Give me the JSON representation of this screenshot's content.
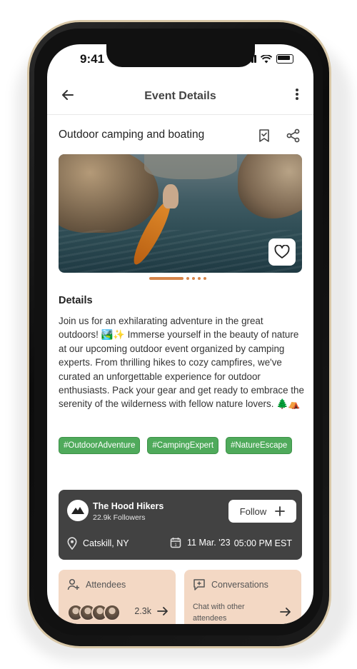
{
  "status_bar": {
    "time": "9:41"
  },
  "header": {
    "title": "Event Details"
  },
  "event": {
    "title": "Outdoor camping and boating",
    "carousel": {
      "slides": 5,
      "active": 1
    }
  },
  "details": {
    "heading": "Details",
    "text": "Join us for an exhilarating adventure in the great outdoors! 🏞️✨ Immerse yourself in the beauty of nature at our upcoming outdoor event organized by camping experts. From thrilling hikes to cozy campfires, we've curated an unforgettable experience for outdoor enthusiasts. Pack your gear and get ready to embrace the serenity of the wilderness with fellow nature lovers. 🌲⛺"
  },
  "tags": [
    "#OutdoorAdventure",
    "#CampingExpert",
    "#NatureEscape"
  ],
  "organizer": {
    "name": "The Hood Hikers",
    "followers": "22.9k Followers",
    "follow_label": "Follow",
    "location": "Catskill, NY",
    "date": "11 Mar. '23",
    "time": "05:00 PM EST"
  },
  "attendees": {
    "label": "Attendees",
    "count": "2.3k"
  },
  "conversations": {
    "label": "Conversations",
    "subtitle": "Chat with other attendees"
  },
  "colors": {
    "accent": "#d6854a",
    "tag_green": "#4faa5b",
    "card_dark": "#424242",
    "card_peach": "#f3d8c4"
  },
  "icons": {
    "back": "arrow-left-icon",
    "more": "more-vertical-icon",
    "bookmark": "bookmark-check-icon",
    "share": "share-icon",
    "heart": "heart-icon",
    "location": "map-pin-icon",
    "calendar": "calendar-icon",
    "plus": "plus-icon",
    "attendees": "user-plus-icon",
    "chat": "chat-plus-icon",
    "arrow": "arrow-right-icon"
  }
}
